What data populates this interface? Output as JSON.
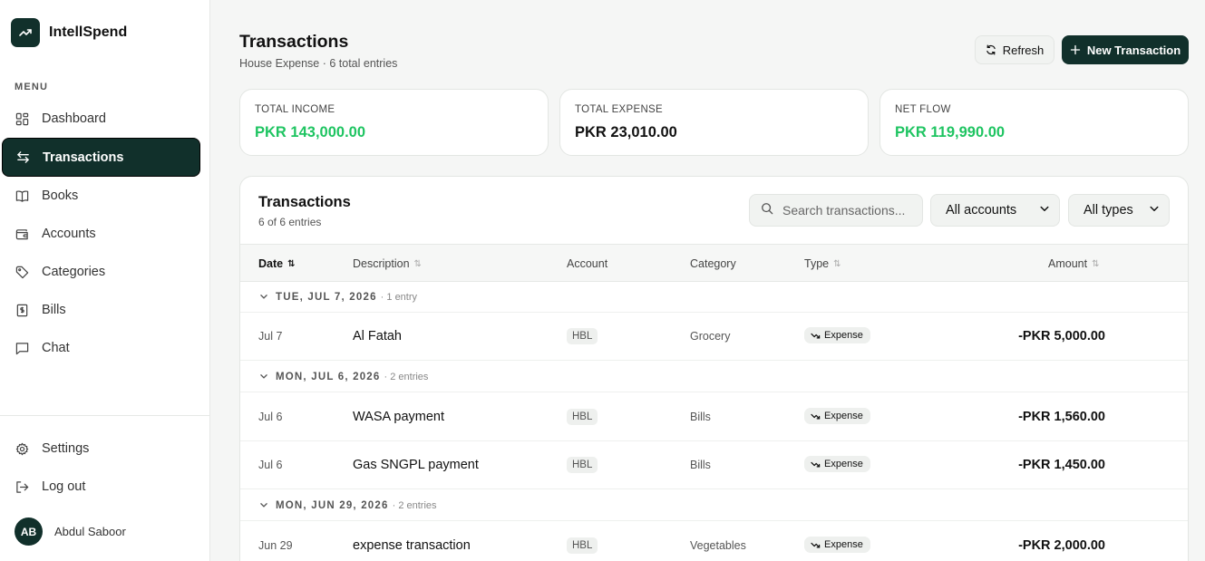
{
  "app": {
    "name": "IntellSpend"
  },
  "sidebar": {
    "menu_label": "MENU",
    "items": [
      {
        "label": "Dashboard",
        "icon": "dashboard-icon"
      },
      {
        "label": "Transactions",
        "icon": "arrows-swap-icon",
        "active": true
      },
      {
        "label": "Books",
        "icon": "book-icon"
      },
      {
        "label": "Accounts",
        "icon": "wallet-icon"
      },
      {
        "label": "Categories",
        "icon": "tag-icon"
      },
      {
        "label": "Bills",
        "icon": "receipt-icon"
      },
      {
        "label": "Chat",
        "icon": "chat-icon"
      }
    ],
    "bottom": [
      {
        "label": "Settings",
        "icon": "gear-icon"
      },
      {
        "label": "Log out",
        "icon": "logout-icon"
      }
    ],
    "user": {
      "initials": "AB",
      "name": "Abdul Saboor"
    }
  },
  "header": {
    "title": "Transactions",
    "subtitle": "House Expense · 6 total entries",
    "refresh_label": "Refresh",
    "new_label": "New Transaction"
  },
  "stats": [
    {
      "label": "TOTAL INCOME",
      "value": "PKR 143,000.00"
    },
    {
      "label": "TOTAL EXPENSE",
      "value": "PKR 23,010.00"
    },
    {
      "label": "NET FLOW",
      "value": "PKR 119,990.00"
    }
  ],
  "table": {
    "title": "Transactions",
    "subtitle": "6 of 6 entries",
    "search_placeholder": "Search transactions...",
    "account_filter": "All accounts",
    "type_filter": "All types",
    "columns": [
      "Date",
      "Description",
      "Account",
      "Category",
      "Type",
      "Amount"
    ],
    "groups": [
      {
        "date": "TUE, JUL 7, 2026",
        "count": "· 1 entry",
        "rows": [
          {
            "date": "Jul 7",
            "description": "Al Fatah",
            "account": "HBL",
            "category": "Grocery",
            "type": "Expense",
            "amount": "-PKR 5,000.00"
          }
        ]
      },
      {
        "date": "MON, JUL 6, 2026",
        "count": "· 2 entries",
        "rows": [
          {
            "date": "Jul 6",
            "description": "WASA payment",
            "account": "HBL",
            "category": "Bills",
            "type": "Expense",
            "amount": "-PKR 1,560.00"
          },
          {
            "date": "Jul 6",
            "description": "Gas SNGPL payment",
            "account": "HBL",
            "category": "Bills",
            "type": "Expense",
            "amount": "-PKR 1,450.00"
          }
        ]
      },
      {
        "date": "MON, JUN 29, 2026",
        "count": "· 2 entries",
        "rows": [
          {
            "date": "Jun 29",
            "description": "expense transaction",
            "account": "HBL",
            "category": "Vegetables",
            "type": "Expense",
            "amount": "-PKR 2,000.00"
          }
        ]
      }
    ]
  },
  "colors": {
    "brand": "#11302b",
    "positive": "#1ec461"
  }
}
